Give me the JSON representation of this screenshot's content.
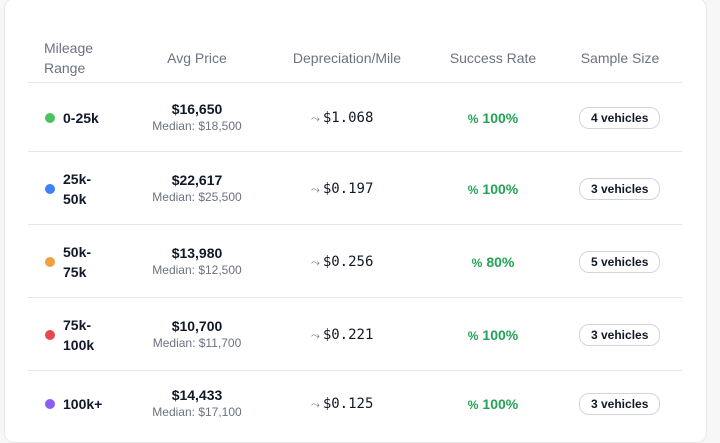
{
  "colors": {
    "success": "#22a355",
    "dot_green": "#4cc15f",
    "dot_blue": "#3b82f6",
    "dot_orange": "#f0a03c",
    "dot_red": "#e5484d",
    "dot_purple": "#8b5cf6"
  },
  "table": {
    "headers": {
      "mileage_range": "Mileage Range",
      "avg_price": "Avg Price",
      "depreciation": "Depreciation/Mile",
      "success_rate": "Success Rate",
      "sample_size": "Sample Size"
    },
    "rows": [
      {
        "range": "0-25k",
        "dot_color": "dot_green",
        "avg_price": "$16,650",
        "median": "Median: $18,500",
        "depreciation": "$1.068",
        "success": "100%",
        "sample": "4 vehicles"
      },
      {
        "range": "25k-50k",
        "dot_color": "dot_blue",
        "avg_price": "$22,617",
        "median": "Median: $25,500",
        "depreciation": "$0.197",
        "success": "100%",
        "sample": "3 vehicles"
      },
      {
        "range": "50k-75k",
        "dot_color": "dot_orange",
        "avg_price": "$13,980",
        "median": "Median: $12,500",
        "depreciation": "$0.256",
        "success": "80%",
        "sample": "5 vehicles"
      },
      {
        "range": "75k-100k",
        "dot_color": "dot_red",
        "avg_price": "$10,700",
        "median": "Median: $11,700",
        "depreciation": "$0.221",
        "success": "100%",
        "sample": "3 vehicles"
      },
      {
        "range": "100k+",
        "dot_color": "dot_purple",
        "avg_price": "$14,433",
        "median": "Median: $17,100",
        "depreciation": "$0.125",
        "success": "100%",
        "sample": "3 vehicles"
      }
    ]
  },
  "icons": {
    "trend": "trend-down-icon",
    "percent": "percent-icon"
  }
}
